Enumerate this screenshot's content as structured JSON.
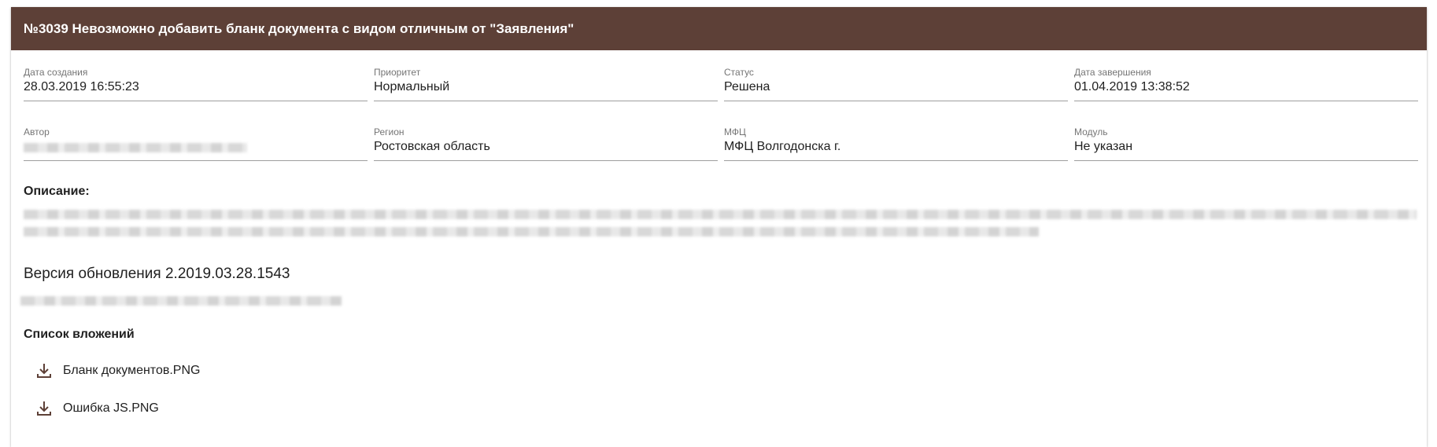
{
  "header": {
    "title": "№3039 Невозможно добавить бланк документа с видом отличным от \"Заявления\""
  },
  "colors": {
    "header_bg": "#5d4037",
    "icon": "#5d4037"
  },
  "fields_row1": [
    {
      "label": "Дата создания",
      "value": "28.03.2019 16:55:23"
    },
    {
      "label": "Приоритет",
      "value": "Нормальный"
    },
    {
      "label": "Статус",
      "value": "Решена"
    },
    {
      "label": "Дата завершения",
      "value": "01.04.2019 13:38:52"
    }
  ],
  "fields_row2": [
    {
      "label": "Автор",
      "value": ""
    },
    {
      "label": "Регион",
      "value": "Ростовская область"
    },
    {
      "label": "МФЦ",
      "value": "МФЦ Волгодонска г."
    },
    {
      "label": "Модуль",
      "value": "Не указан"
    }
  ],
  "description": {
    "title": "Описание:"
  },
  "version": {
    "text": "Версия обновления 2.2019.03.28.1543"
  },
  "attachments": {
    "title": "Список вложений",
    "items": [
      {
        "name": "Бланк документов.PNG",
        "icon": "download-icon"
      },
      {
        "name": "Ошибка JS.PNG",
        "icon": "download-icon"
      }
    ]
  }
}
